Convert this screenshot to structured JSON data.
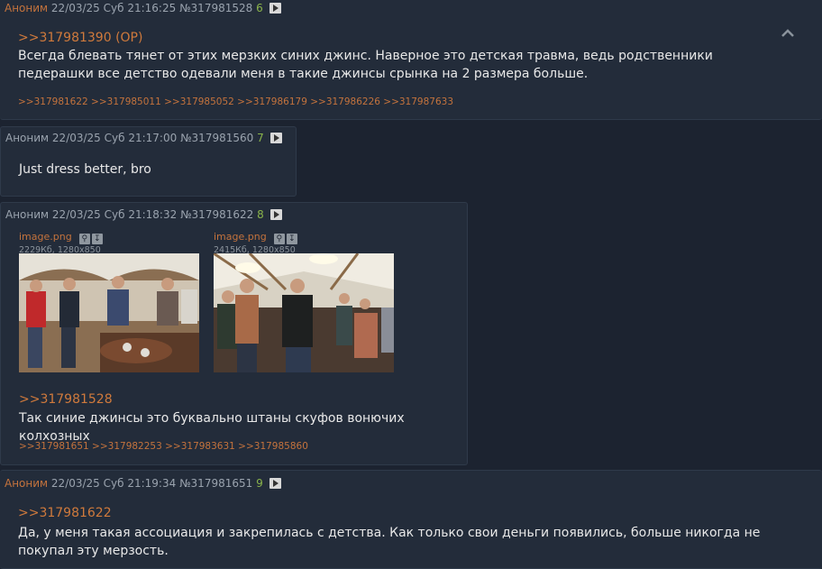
{
  "posts": [
    {
      "name": "Аноним",
      "date": "22/03/25 Суб 21:16:25",
      "num": "№317981528",
      "count": "6",
      "reply_to": ">>317981390 (OP)",
      "text": "Всегда блевать тянет от этих мерзких синих джинс. Наверное это детская травма, ведь родственники педерашки все детство одевали меня в такие джинсы срынка на 2 размера больше.",
      "backlinks": ">>317981622 >>317985011 >>317985052 >>317986179 >>317986226 >>317987633"
    },
    {
      "name": "Аноним",
      "date": "22/03/25 Суб 21:17:00",
      "num": "№317981560",
      "count": "7",
      "text": "Just dress better, bro"
    },
    {
      "name": "Аноним",
      "date": "22/03/25 Суб 21:18:32",
      "num": "№317981622",
      "count": "8",
      "files": [
        {
          "name": "image.png",
          "meta": "2229Кб, 1280x850"
        },
        {
          "name": "image.png",
          "meta": "2415Кб, 1280x850"
        }
      ],
      "reply_to": ">>317981528",
      "text": "Так синие джинсы это буквально штаны скуфов вонючих колхозных",
      "backlinks": ">>317981651 >>317982253 >>317983631 >>317985860"
    },
    {
      "name": "Аноним",
      "date": "22/03/25 Суб 21:19:34",
      "num": "№317981651",
      "count": "9",
      "reply_to": ">>317981622",
      "text": "Да, у меня такая ассоциация и закрепилась с детства. Как только свои деньги появились, больше никогда не покупал эту мерзость."
    }
  ],
  "colors": {
    "background": "#1c2330",
    "post_bg": "#232c3a",
    "name": "#c4733d",
    "link": "#d07a3c",
    "count": "#8ab44b"
  },
  "icons": {
    "play": "play-icon",
    "collapse": "chevron-up-icon",
    "search": "search-icon",
    "download": "download-icon"
  }
}
